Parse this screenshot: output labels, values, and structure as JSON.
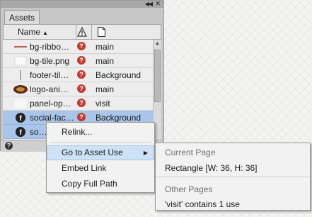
{
  "panel": {
    "tab_label": "Assets",
    "collapse_icon": "double-chevron-left-icon",
    "menu_icon": "panel-menu-icon",
    "header": {
      "name_label": "Name",
      "status_icon": "warning-triangle-icon",
      "page_icon": "page-icon"
    },
    "rows": [
      {
        "name": "bg-ribbo…",
        "page": "main",
        "thumb": "ribbon-thumbnail",
        "selected": false
      },
      {
        "name": "bg-tile.png",
        "page": "main",
        "thumb": "tile-thumbnail",
        "selected": false
      },
      {
        "name": "footer-til…",
        "page": "Background",
        "thumb": "line-thumbnail",
        "selected": false
      },
      {
        "name": "logo-ani…",
        "page": "main",
        "thumb": "logo-thumbnail",
        "selected": false
      },
      {
        "name": "panel-op…",
        "page": "visit",
        "thumb": "blank-thumbnail",
        "selected": false
      },
      {
        "name": "social-fac…",
        "page": "Background",
        "thumb": "facebook-thumbnail",
        "selected": true
      },
      {
        "name": "so…",
        "page": "",
        "thumb": "facebook-thumbnail",
        "selected": true
      }
    ],
    "status_glyph": "?",
    "footer_help": "?"
  },
  "context_menu": {
    "items": [
      "Relink...",
      "Go to Asset Use",
      "Embed Link",
      "Copy Full Path"
    ],
    "hover_index": 1,
    "submenu_arrow": "▶"
  },
  "submenu": {
    "current_header": "Current Page",
    "current_item": "Rectangle [W: 36, H: 36]",
    "other_header": "Other Pages",
    "other_item": "'visit' contains 1 use"
  },
  "colors": {
    "selection": "#a9c6ea",
    "menu_hover": "#cde2f7",
    "status_red": "#c23b2e",
    "facebook": "#3b5998"
  }
}
